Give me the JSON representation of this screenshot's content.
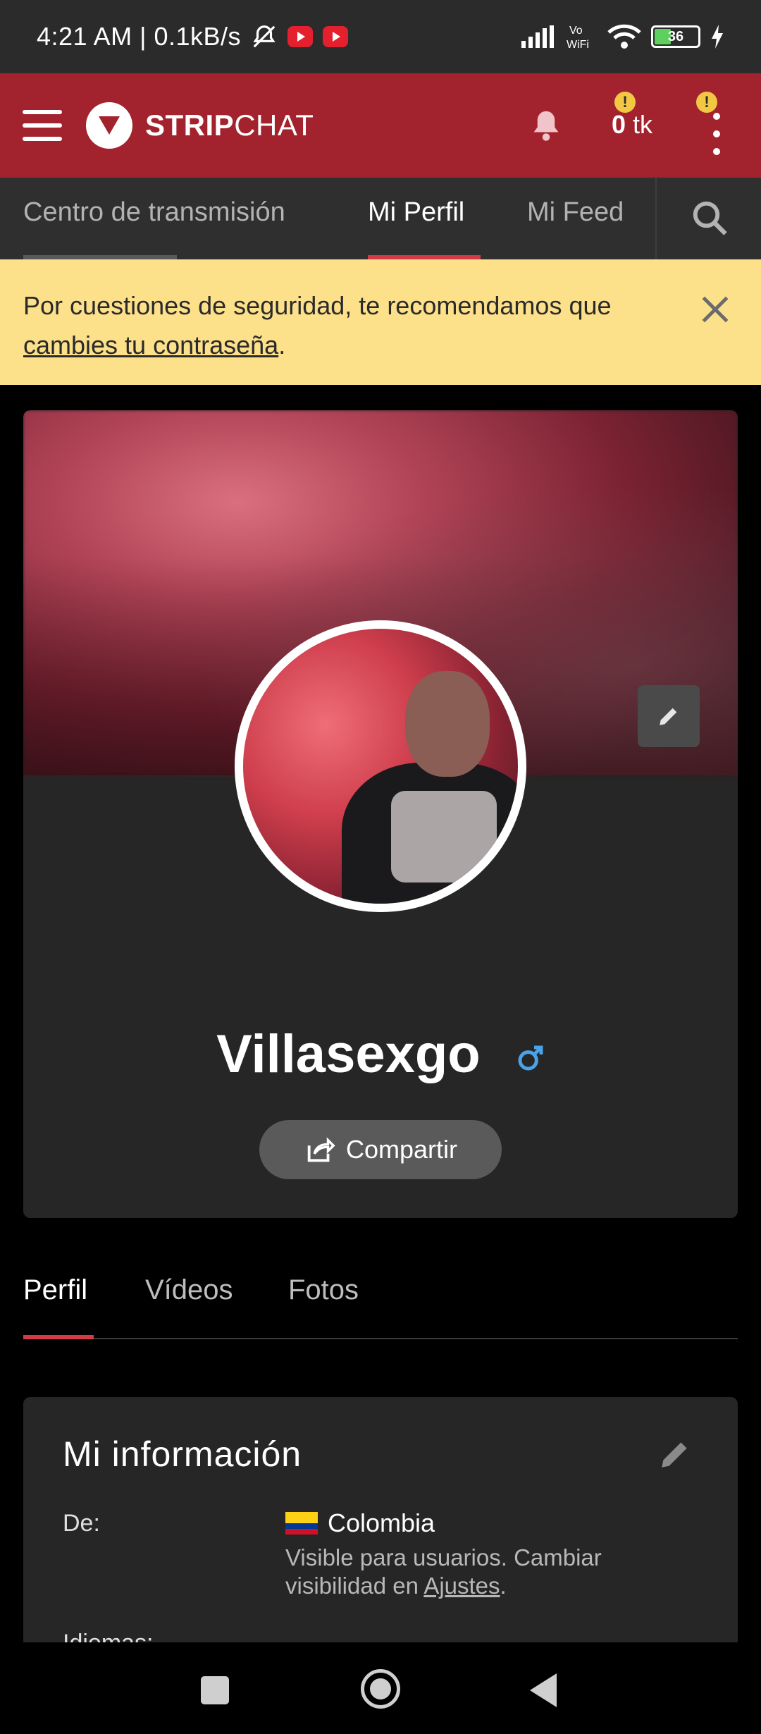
{
  "status_bar": {
    "time": "4:21 AM | 0.1kB/s",
    "battery": "36"
  },
  "app_bar": {
    "brand_bold": "STRIP",
    "brand_light": "CHAT",
    "tokens_value": "0",
    "tokens_unit": "tk",
    "alert_mark": "!"
  },
  "top_tabs": [
    {
      "label": "Centro de transmisión"
    },
    {
      "label": "Mi Perfil"
    },
    {
      "label": "Mi Feed"
    }
  ],
  "notice": {
    "text": "Por cuestiones de seguridad, te recomendamos que",
    "link": "cambies tu contraseña",
    "end": "."
  },
  "profile": {
    "username": "Villasexgo",
    "share_label": "Compartir"
  },
  "profile_tabs": [
    {
      "label": "Perfil"
    },
    {
      "label": "Vídeos"
    },
    {
      "label": "Fotos"
    }
  ],
  "info": {
    "title": "Mi información",
    "from_label": "De:",
    "country": "Colombia",
    "hint_text": "Visible para usuarios. Cambiar visibilidad en",
    "hint_link": "Ajustes",
    "hint_end": ".",
    "languages_label": "Idiomas:"
  },
  "colors": {
    "brand": "#a2232d",
    "notice_bg": "#fde08a",
    "accent_line": "#d43a47",
    "male_icon": "#4aa3e8"
  }
}
